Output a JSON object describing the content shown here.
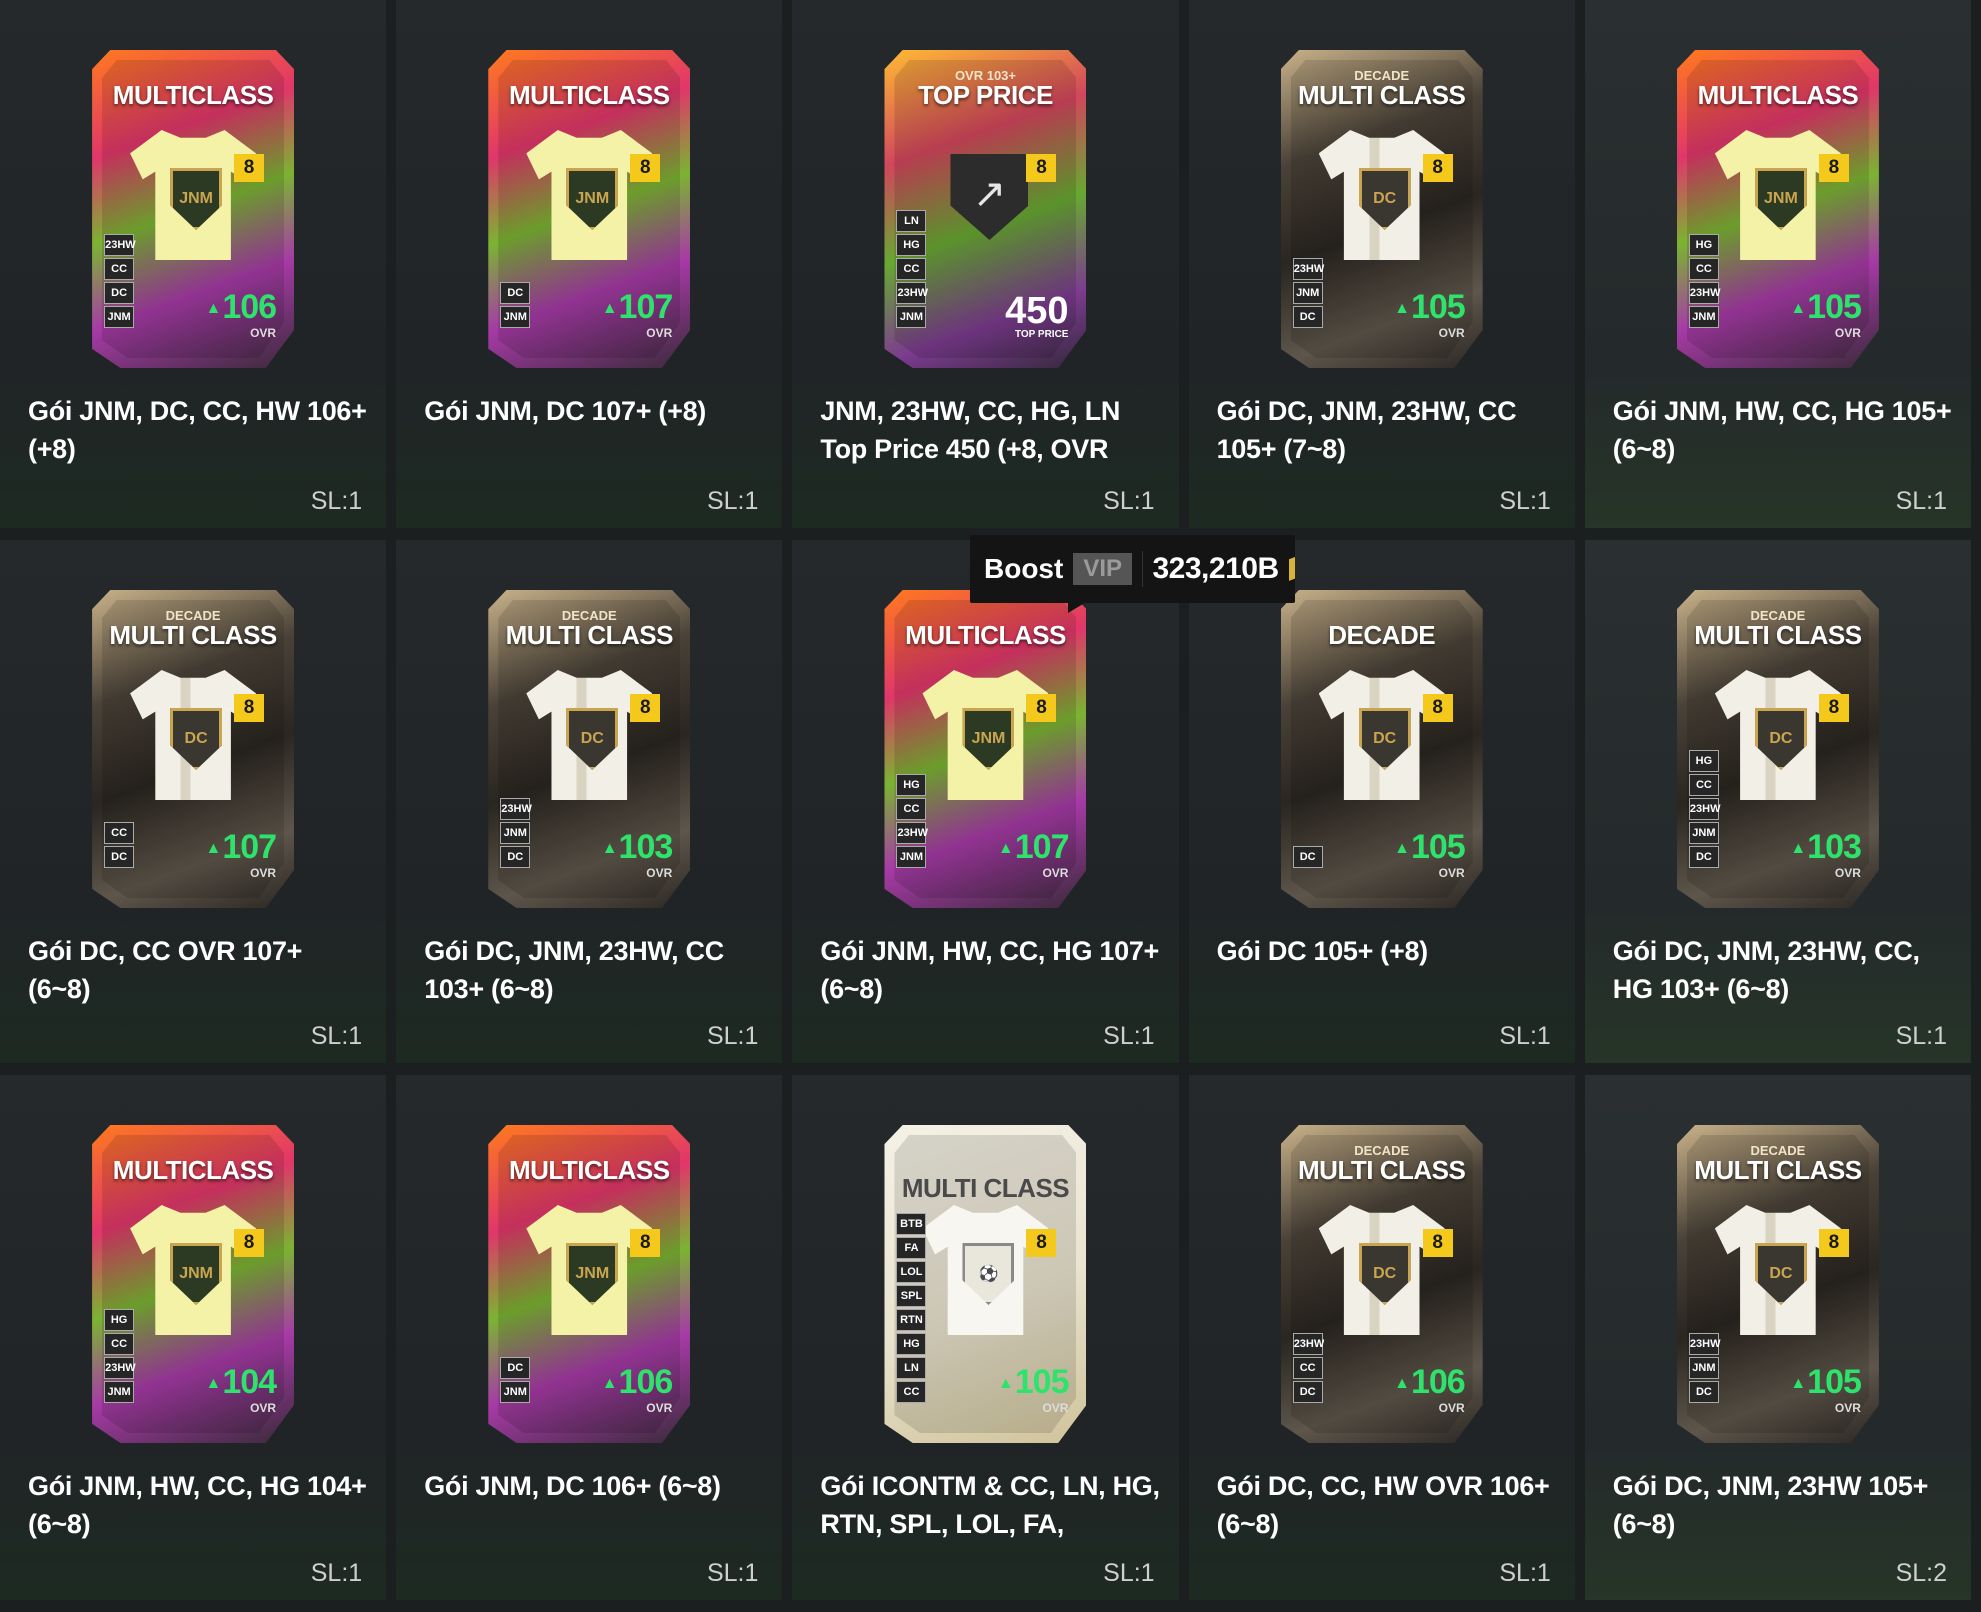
{
  "packs": [
    {
      "name": "Gói JNM, DC, CC, HW 106+ (+8)",
      "style": "mc",
      "card_title": "MULTICLASS",
      "card_sub": "",
      "emblem": "crest",
      "level": "8",
      "tags": [
        "23HW",
        "CC",
        "DC",
        "JNM"
      ],
      "ovr": "106",
      "ovr_label": "OVR",
      "qty": "SL:1"
    },
    {
      "name": "Gói JNM, DC 107+ (+8)",
      "style": "mc",
      "card_title": "MULTICLASS",
      "card_sub": "",
      "emblem": "crest",
      "level": "8",
      "tags": [
        "DC",
        "JNM"
      ],
      "ovr": "107",
      "ovr_label": "OVR",
      "qty": "SL:1"
    },
    {
      "name": "JNM, 23HW, CC, HG, LN Top Price 450 (+8, OVR",
      "style": "top",
      "card_title": "TOP PRICE",
      "card_sub": "OVR 103+",
      "emblem": "trend",
      "level": "8",
      "tags": [
        "LN",
        "HG",
        "CC",
        "23HW",
        "JNM"
      ],
      "ovr": "450",
      "ovr_label": "TOP PRICE",
      "qty": "SL:1"
    },
    {
      "name": "Gói DC, JNM, 23HW, CC 105+ (7~8)",
      "style": "decade",
      "card_title": "MULTI CLASS",
      "card_sub": "DECADE",
      "emblem": "dc",
      "level": "8",
      "tags": [
        "23HW",
        "JNM",
        "DC"
      ],
      "ovr": "105",
      "ovr_label": "OVR",
      "qty": "SL:1"
    },
    {
      "name": "Gói JNM, HW, CC, HG 105+ (6~8)",
      "style": "mc",
      "card_title": "MULTICLASS",
      "card_sub": "",
      "emblem": "crest",
      "level": "8",
      "tags": [
        "HG",
        "CC",
        "23HW",
        "JNM"
      ],
      "ovr": "105",
      "ovr_label": "OVR",
      "qty": "SL:1"
    },
    {
      "name": "Gói DC, CC OVR 107+ (6~8)",
      "style": "decade",
      "card_title": "MULTI CLASS",
      "card_sub": "DECADE",
      "emblem": "dc",
      "level": "8",
      "tags": [
        "CC",
        "DC"
      ],
      "ovr": "107",
      "ovr_label": "OVR",
      "qty": "SL:1"
    },
    {
      "name": "Gói DC, JNM, 23HW, CC 103+ (6~8)",
      "style": "decade",
      "card_title": "MULTI CLASS",
      "card_sub": "DECADE",
      "emblem": "dc",
      "level": "8",
      "tags": [
        "23HW",
        "JNM",
        "DC"
      ],
      "ovr": "103",
      "ovr_label": "OVR",
      "qty": "SL:1"
    },
    {
      "name": "Gói JNM, HW, CC, HG 107+ (6~8)",
      "style": "mc",
      "card_title": "MULTICLASS",
      "card_sub": "",
      "emblem": "crest",
      "level": "8",
      "tags": [
        "HG",
        "CC",
        "23HW",
        "JNM"
      ],
      "ovr": "107",
      "ovr_label": "OVR",
      "qty": "SL:1"
    },
    {
      "name": "Gói DC 105+ (+8)",
      "style": "decade",
      "card_title": "DECADE",
      "card_sub": "",
      "emblem": "dc",
      "level": "8",
      "tags": [
        "DC"
      ],
      "ovr": "105",
      "ovr_label": "OVR",
      "qty": "SL:1"
    },
    {
      "name": "Gói DC, JNM, 23HW, CC, HG 103+ (6~8)",
      "style": "decade",
      "card_title": "MULTI CLASS",
      "card_sub": "DECADE",
      "emblem": "dc",
      "level": "8",
      "tags": [
        "HG",
        "CC",
        "23HW",
        "JNM",
        "DC"
      ],
      "ovr": "103",
      "ovr_label": "OVR",
      "qty": "SL:1"
    },
    {
      "name": "Gói JNM, HW, CC, HG 104+ (6~8)",
      "style": "mc",
      "card_title": "MULTICLASS",
      "card_sub": "",
      "emblem": "crest",
      "level": "8",
      "tags": [
        "HG",
        "CC",
        "23HW",
        "JNM"
      ],
      "ovr": "104",
      "ovr_label": "OVR",
      "qty": "SL:1"
    },
    {
      "name": "Gói JNM, DC 106+ (6~8)",
      "style": "mc",
      "card_title": "MULTICLASS",
      "card_sub": "",
      "emblem": "crest",
      "level": "8",
      "tags": [
        "DC",
        "JNM"
      ],
      "ovr": "106",
      "ovr_label": "OVR",
      "qty": "SL:1"
    },
    {
      "name": "Gói ICONTM & CC, LN, HG, RTN, SPL, LOL, FA,",
      "style": "icon",
      "card_title": "MULTI CLASS",
      "card_sub": "",
      "emblem": "icon",
      "level": "8",
      "tags": [
        "BTB",
        "FA",
        "LOL",
        "SPL",
        "RTN",
        "HG",
        "LN",
        "CC"
      ],
      "ovr": "105",
      "ovr_label": "OVR",
      "qty": "SL:1"
    },
    {
      "name": "Gói DC, CC, HW OVR 106+ (6~8)",
      "style": "decade",
      "card_title": "MULTI CLASS",
      "card_sub": "DECADE",
      "emblem": "dc",
      "level": "8",
      "tags": [
        "23HW",
        "CC",
        "DC"
      ],
      "ovr": "106",
      "ovr_label": "OVR",
      "qty": "SL:1"
    },
    {
      "name": "Gói DC, JNM, 23HW 105+ (6~8)",
      "style": "decade",
      "card_title": "MULTI CLASS",
      "card_sub": "DECADE",
      "emblem": "dc",
      "level": "8",
      "tags": [
        "23HW",
        "JNM",
        "DC"
      ],
      "ovr": "105",
      "ovr_label": "OVR",
      "qty": "SL:2"
    }
  ],
  "boost": {
    "label": "Boost",
    "vip": "VIP",
    "coins": "323,210B"
  },
  "colors": {
    "ovr_green": "#2ee36b",
    "level_yellow": "#f4c91b",
    "background": "#1b1f20"
  }
}
